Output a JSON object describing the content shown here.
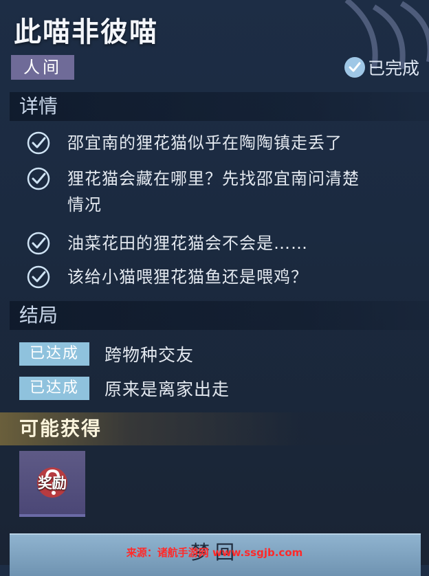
{
  "quest": {
    "title": "此喵非彼喵",
    "realm_tag": "人间",
    "status": "已完成"
  },
  "details": {
    "heading": "详情",
    "items": [
      {
        "text": "邵宜南的狸花猫似乎在陶陶镇走丢了"
      },
      {
        "text": "狸花猫会藏在哪里？先找邵宜南问清楚"
      },
      {
        "text": "情况"
      },
      {
        "text": "油菜花田的狸花猫会不会是……"
      },
      {
        "text": "该给小猫喂狸花猫鱼还是喂鸡？"
      }
    ]
  },
  "endings": {
    "heading": "结局",
    "items": [
      {
        "badge": "已达成",
        "text": "跨物种交友"
      },
      {
        "badge": "已达成",
        "text": "原来是离家出走"
      }
    ]
  },
  "rewards": {
    "heading": "可能获得",
    "item_label": "奖励"
  },
  "bottom_button": {
    "label": "梦回"
  },
  "watermark": "来源：诸航手游网 www.ssgjb.com",
  "colors": {
    "tag_bg": "#6f6b98",
    "badge_bg": "#8fc2dd",
    "check": "#cfe3f4",
    "reward_bg": "#5e5a86"
  }
}
